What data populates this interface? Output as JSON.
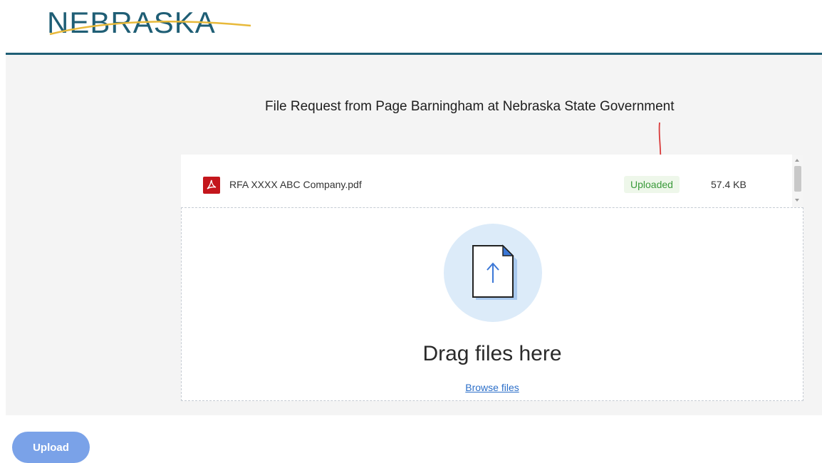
{
  "header": {
    "logo_text": "NEBRASKA",
    "brand_color": "#1f5e75",
    "swoosh_color": "#e8b93a"
  },
  "request": {
    "title": "File Request from Page Barningham at Nebraska State Government"
  },
  "files": [
    {
      "name": "RFA XXXX ABC Company.pdf",
      "icon": "pdf-icon",
      "status": "Uploaded",
      "size": "57.4 KB"
    }
  ],
  "dropzone": {
    "icon": "document-upload-icon",
    "title": "Drag files here",
    "browse_label": "Browse files"
  },
  "actions": {
    "upload_label": "Upload"
  },
  "colors": {
    "annotation_arrow": "#d93a3a",
    "status_green": "#3a9a3a",
    "link_blue": "#2c6fc9",
    "button_blue": "#7aa2e8"
  }
}
